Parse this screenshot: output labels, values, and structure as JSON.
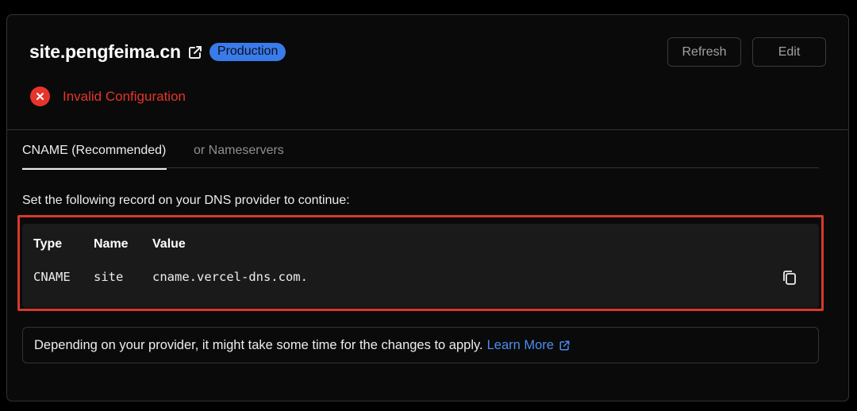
{
  "domain": {
    "name": "site.pengfeima.cn",
    "badge": "Production"
  },
  "actions": {
    "refresh_label": "Refresh",
    "edit_label": "Edit"
  },
  "status": {
    "text": "Invalid Configuration",
    "color": "#e5352b"
  },
  "tabs": [
    {
      "label": "CNAME (Recommended)",
      "active": true
    },
    {
      "label": "or Nameservers",
      "active": false
    }
  ],
  "instructions": "Set the following record on your DNS provider to continue:",
  "record": {
    "headers": [
      "Type",
      "Name",
      "Value"
    ],
    "row": [
      "CNAME",
      "site",
      "cname.vercel-dns.com."
    ]
  },
  "note": {
    "text": "Depending on your provider, it might take some time for the changes to apply.",
    "link_label": "Learn More"
  },
  "colors": {
    "accent": "#3a7bea",
    "error": "#e5352b",
    "highlight": "#d7392b",
    "link": "#4a8df0"
  },
  "icons": [
    "external-link-icon",
    "error-x-icon",
    "copy-icon"
  ]
}
